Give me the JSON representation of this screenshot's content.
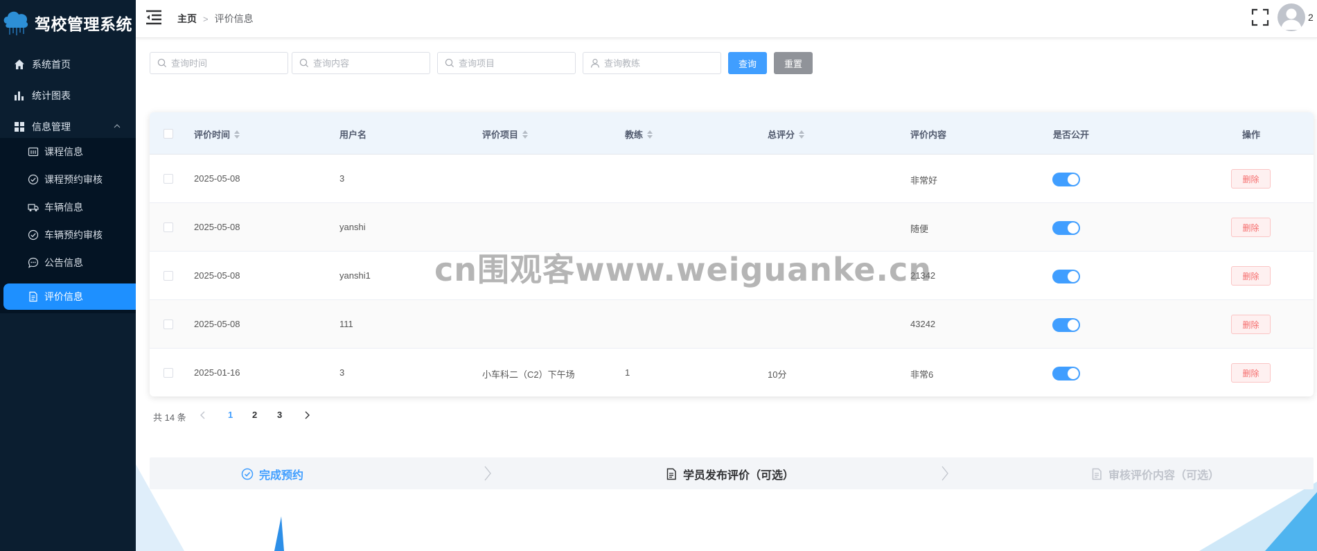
{
  "sidebar": {
    "brand_title": "驾校管理系统",
    "items": [
      {
        "label": "系统首页",
        "icon": "home-icon"
      },
      {
        "label": "统计图表",
        "icon": "bar-chart-icon"
      },
      {
        "label": "信息管理",
        "icon": "grid-icon"
      }
    ],
    "submenu": [
      {
        "label": "课程信息",
        "icon": "calendar-icon"
      },
      {
        "label": "课程预约审核",
        "icon": "check-circle-icon"
      },
      {
        "label": "车辆信息",
        "icon": "truck-icon"
      },
      {
        "label": "车辆预约审核",
        "icon": "check-circle-icon"
      },
      {
        "label": "公告信息",
        "icon": "chat-icon"
      },
      {
        "label": "评价信息",
        "icon": "document-icon",
        "active": true
      }
    ]
  },
  "header": {
    "breadcrumb_home": "主页",
    "breadcrumb_sep": ">",
    "breadcrumb_current": "评价信息",
    "user_name": "2"
  },
  "search": {
    "time_placeholder": "查询时间",
    "content_placeholder": "查询内容",
    "project_placeholder": "查询项目",
    "coach_placeholder": "查询教练",
    "query_label": "查询",
    "reset_label": "重置"
  },
  "table": {
    "headers": {
      "time": "评价时间",
      "user": "用户名",
      "project": "评价项目",
      "coach": "教练",
      "score": "总评分",
      "content": "评价内容",
      "public": "是否公开",
      "action": "操作"
    },
    "rows": [
      {
        "time": "2025-05-08",
        "user": "3",
        "project": "",
        "coach": "",
        "score": "",
        "content": "非常好",
        "public": true
      },
      {
        "time": "2025-05-08",
        "user": "yanshi",
        "project": "",
        "coach": "",
        "score": "",
        "content": "随便",
        "public": true
      },
      {
        "time": "2025-05-08",
        "user": "yanshi1",
        "project": "",
        "coach": "",
        "score": "",
        "content": "21342",
        "public": true
      },
      {
        "time": "2025-05-08",
        "user": "111",
        "project": "",
        "coach": "",
        "score": "",
        "content": "43242",
        "public": true
      },
      {
        "time": "2025-01-16",
        "user": "3",
        "project": "小车科二（C2）下午场",
        "coach": "1",
        "score": "10分",
        "content": "非常6",
        "public": true
      }
    ],
    "delete_label": "删除"
  },
  "pagination": {
    "total_text": "共 14 条",
    "pages": [
      "1",
      "2",
      "3"
    ],
    "current": "1"
  },
  "steps": {
    "done": "完成预约",
    "current": "学员发布评价（可选）",
    "wait": "审核评价内容（可选）"
  },
  "watermark": "cn围观客www.weiguanke.cn",
  "colors": {
    "sidebar_bg": "#0b1e30",
    "accent": "#1e90ff",
    "danger": "#f56c6c",
    "header_row": "#eef5fc"
  }
}
